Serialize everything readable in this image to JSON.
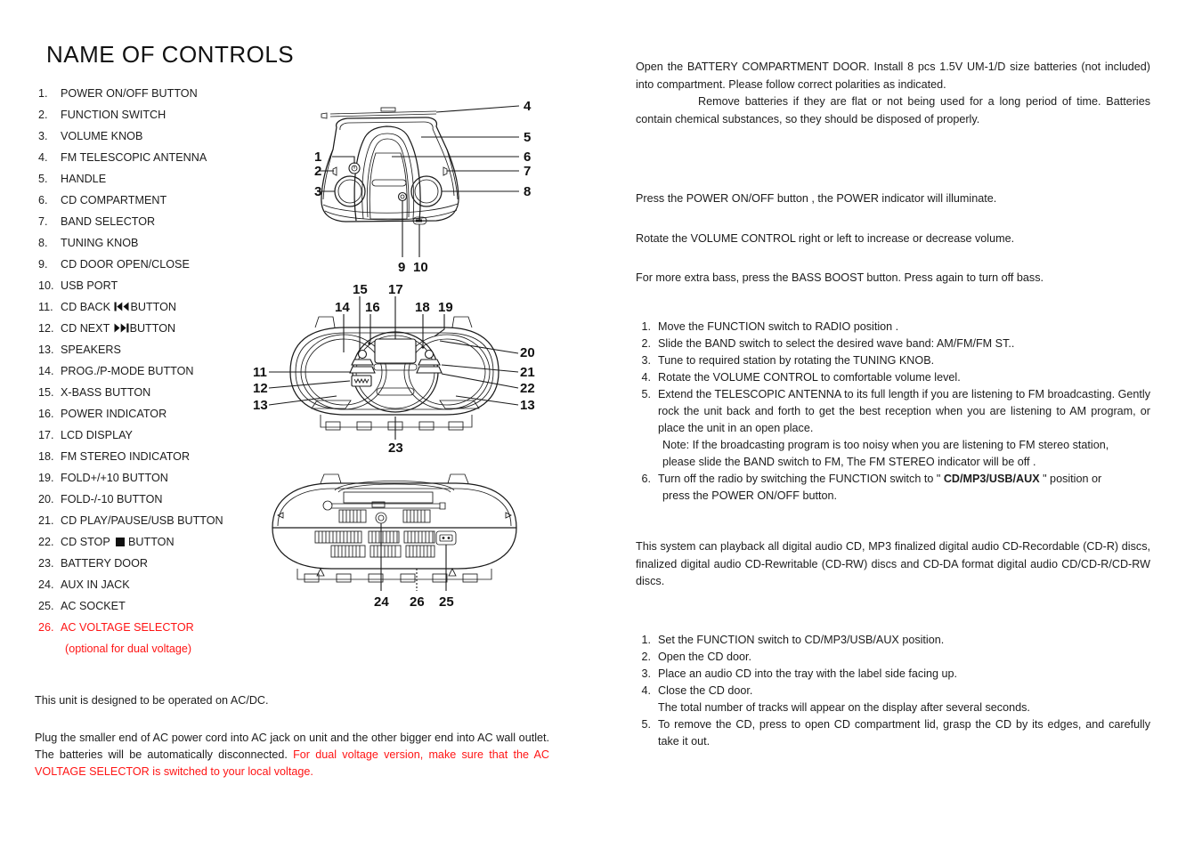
{
  "document": {
    "title": "NAME OF CONTROLS"
  },
  "controls_list": [
    {
      "num": "1.",
      "label": "POWER ON/OFF BUTTON"
    },
    {
      "num": "2.",
      "label": "FUNCTION SWITCH"
    },
    {
      "num": "3.",
      "label": "VOLUME KNOB"
    },
    {
      "num": "4.",
      "label": "FM TELESCOPIC ANTENNA"
    },
    {
      "num": "5.",
      "label": "HANDLE"
    },
    {
      "num": "6.",
      "label": "CD COMPARTMENT"
    },
    {
      "num": "7.",
      "label": "BAND SELECTOR"
    },
    {
      "num": "8.",
      "label": "TUNING KNOB"
    },
    {
      "num": "9.",
      "label": "CD DOOR OPEN/CLOSE"
    },
    {
      "num": "10.",
      "label": "USB PORT"
    },
    {
      "num": "11.",
      "label_pre": "CD BACK",
      "icon": "previous-track-icon",
      "label_post": "BUTTON"
    },
    {
      "num": "12.",
      "label_pre": "CD NEXT",
      "icon": "next-track-icon",
      "label_post": "BUTTON"
    },
    {
      "num": "13.",
      "label": "SPEAKERS"
    },
    {
      "num": "14.",
      "label": "PROG./P-MODE BUTTON"
    },
    {
      "num": "15.",
      "label": "X-BASS BUTTON"
    },
    {
      "num": "16.",
      "label": "POWER INDICATOR"
    },
    {
      "num": "17.",
      "label": "LCD DISPLAY"
    },
    {
      "num": "18.",
      "label": "FM STEREO INDICATOR"
    },
    {
      "num": "19.",
      "label": "FOLD+/+10 BUTTON"
    },
    {
      "num": "20.",
      "label": "FOLD-/-10 BUTTON"
    },
    {
      "num": "21.",
      "label": "CD PLAY/PAUSE/USB BUTTON"
    },
    {
      "num": "22.",
      "label_pre": "CD STOP",
      "icon": "stop-square-icon",
      "label_post": "BUTTON"
    },
    {
      "num": "23.",
      "label": "BATTERY DOOR"
    },
    {
      "num": "24.",
      "label": "AUX IN JACK"
    },
    {
      "num": "25.",
      "label": "AC SOCKET"
    },
    {
      "num": "26.",
      "label": "AC VOLTAGE SELECTOR",
      "color": "#ff1414",
      "note": "(optional for dual voltage)"
    }
  ],
  "colors": {
    "red_highlight": "#ff1414",
    "body_text": "#1c1c1c"
  },
  "left_notes": {
    "ac_dc": "This unit is designed to be operated on AC/DC.",
    "ac_plug_black": "Plug the smaller end of AC power cord into AC jack on unit and the other bigger end into AC wall outlet. The batteries will be automatically disconnected. ",
    "ac_plug_red": "For dual voltage version, make sure that the AC VOLTAGE SELECTOR is switched to your local voltage."
  },
  "diagrams": {
    "top_view": {
      "name": "top-front-view",
      "callouts": [
        "1",
        "2",
        "3",
        "4",
        "5",
        "6",
        "7",
        "8",
        "9",
        "10"
      ]
    },
    "front_view": {
      "name": "front-panel-view",
      "callouts": [
        "11",
        "12",
        "13",
        "14",
        "15",
        "16",
        "17",
        "18",
        "19",
        "20",
        "21",
        "22",
        "23"
      ]
    },
    "back_view": {
      "name": "rear-view",
      "callouts": [
        "24",
        "25",
        "26"
      ]
    }
  },
  "right_column": {
    "battery": {
      "p1": "Open the BATTERY COMPARTMENT DOOR. Install 8 pcs 1.5V UM-1/D size batteries (not included) into compartment. Please follow correct polarities as indicated.",
      "p2": "Remove batteries if they are flat or not being used for a long period of time. Batteries contain chemical substances, so they should be disposed of properly."
    },
    "power": "Press the POWER ON/OFF button , the POWER indicator will illuminate.",
    "volume": "Rotate the VOLUME CONTROL right or left to increase or decrease volume.",
    "bass": "For more extra bass, press the BASS BOOST button. Press again to turn off bass.",
    "radio_steps": [
      {
        "n": "1.",
        "t": "Move the FUNCTION switch to RADIO position ."
      },
      {
        "n": "2.",
        "t": "Slide the BAND switch to select the desired wave band: AM/FM/FM ST.."
      },
      {
        "n": "3.",
        "t": "Tune to required station by rotating the TUNING KNOB."
      },
      {
        "n": "4.",
        "t": "Rotate the VOLUME CONTROL to comfortable volume level."
      },
      {
        "n": "5.",
        "t": "Extend the TELESCOPIC ANTENNA to its full length if you are listening to FM broadcasting. Gently rock the unit back and forth to get the best reception when you are listening to AM program, or place the unit in an open place."
      }
    ],
    "radio_note_1": "Note: If the broadcasting program is too noisy when you are listening to FM stereo station,",
    "radio_note_2": "please slide the BAND switch to FM, The FM STEREO indicator will be off .",
    "radio_step6": {
      "n": "6.",
      "pre": "Turn off the radio by switching the FUNCTION switch to \" ",
      "bold": "CD/MP3/USB/AUX",
      "post": " \" position or"
    },
    "radio_step6_cont": "press the POWER ON/OFF button.",
    "disc_types": "This system can playback all digital audio CD, MP3 finalized digital audio CD-Recordable (CD-R) discs, finalized digital audio CD-Rewritable (CD-RW) discs and CD-DA format digital audio CD/CD-R/CD-RW discs.",
    "cd_steps": [
      {
        "n": "1.",
        "t": "Set the FUNCTION switch to CD/MP3/USB/AUX position."
      },
      {
        "n": "2.",
        "t": "Open the CD door."
      },
      {
        "n": "3.",
        "t": "Place an audio CD into the tray with the label side facing up."
      },
      {
        "n": "4.",
        "t": "Close the CD door."
      }
    ],
    "cd_step4_cont": "The total number of tracks will appear on the display after several seconds.",
    "cd_step5": {
      "n": "5.",
      "t": "To remove the CD, press to open CD compartment lid, grasp the CD by its edges, and carefully take it out."
    }
  }
}
